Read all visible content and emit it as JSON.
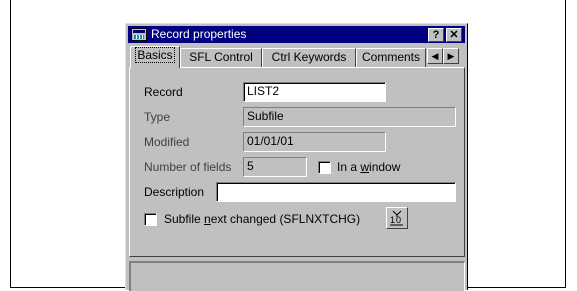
{
  "window": {
    "title": "Record properties",
    "help_button": "?",
    "close_button": "✕"
  },
  "tabs": [
    {
      "label": "Basics"
    },
    {
      "label": "SFL Control"
    },
    {
      "label": "Ctrl Keywords"
    },
    {
      "label": "Comments"
    }
  ],
  "tab_scroll": {
    "left": "◀",
    "right": "▶"
  },
  "form": {
    "record": {
      "label": "Record",
      "value": "LIST2"
    },
    "type": {
      "label": "Type",
      "value": "Subfile"
    },
    "modified": {
      "label": "Modified",
      "value": "01/01/01"
    },
    "number_of_fields": {
      "label": "Number of fields",
      "value": "5"
    },
    "in_window": {
      "label_pre": "In a ",
      "label_accel": "w",
      "label_post": "indow",
      "checked": false
    },
    "description": {
      "label": "Description",
      "value": ""
    },
    "subfile_next_changed": {
      "label_pre": "Subfile ",
      "label_accel": "n",
      "label_post": "ext changed (SFLNXTCHG)",
      "checked": false
    }
  },
  "icons": {
    "window_icon": "record-window-icon",
    "field_indicator_icon": "indicator-icon"
  }
}
